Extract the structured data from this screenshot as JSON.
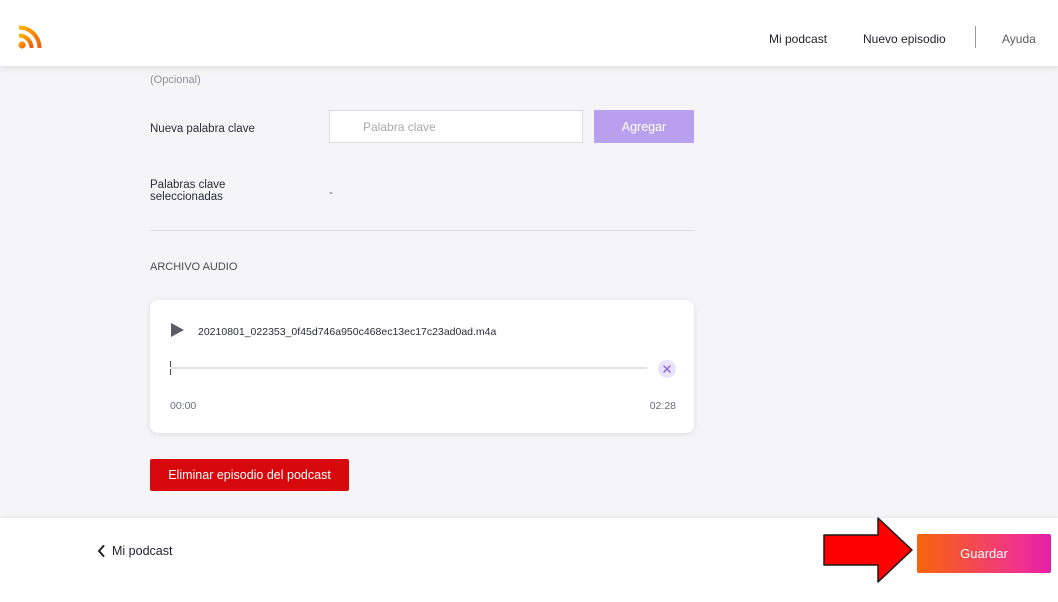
{
  "colors": {
    "brand_orange": "#f7650a",
    "brand_pink": "#e41ea8",
    "accent_purple": "#b9a0ee",
    "danger_red": "#d7090c",
    "pointer_red": "#ff0000"
  },
  "header": {
    "logo_icon": "rss-icon",
    "nav": {
      "mi_podcast": "Mi podcast",
      "nuevo_episodio": "Nuevo episodio",
      "ayuda": "Ayuda"
    }
  },
  "form": {
    "optional_hint": "(Opcional)",
    "keyword_label": "Nueva palabra clave",
    "keyword_input": {
      "placeholder": "Palabra clave",
      "value": ""
    },
    "add_button": "Agregar",
    "selected_label": "Palabras clave seleccionadas",
    "selected_value": "-",
    "audio_section_title": "ARCHIVO AUDIO",
    "audio": {
      "play_icon": "play-icon",
      "filename": "20210801_022353_0f45d746a950c468ec13ec17c23ad0ad.m4a",
      "progress_percent": 0,
      "current_time": "00:00",
      "duration": "02:28",
      "remove_icon": "close-icon"
    },
    "delete_button": "Eliminar episodio del podcast"
  },
  "footer": {
    "back_link": "Mi podcast",
    "back_icon": "chevron-left-icon",
    "save_button": "Guardar",
    "pointer_icon": "arrow-right-icon"
  }
}
